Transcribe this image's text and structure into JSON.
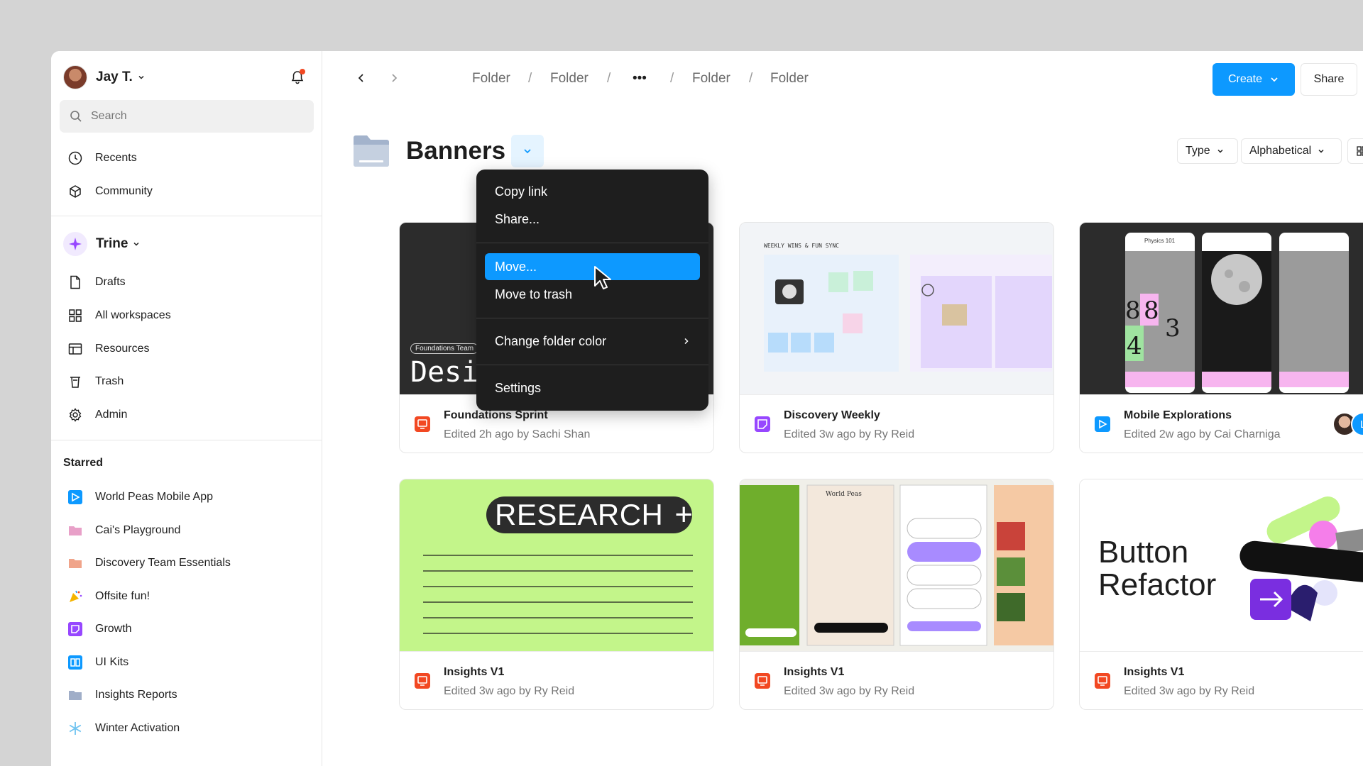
{
  "user": {
    "name": "Jay T."
  },
  "search": {
    "placeholder": "Search"
  },
  "sidebar": {
    "top_items": [
      {
        "label": "Recents",
        "icon": "clock-icon"
      },
      {
        "label": "Community",
        "icon": "globe-box-icon"
      }
    ],
    "team": {
      "name": "Trine"
    },
    "team_items": [
      {
        "label": "Drafts",
        "icon": "file-icon"
      },
      {
        "label": "All workspaces",
        "icon": "grid-icon"
      },
      {
        "label": "Resources",
        "icon": "layout-icon"
      },
      {
        "label": "Trash",
        "icon": "trash-icon"
      },
      {
        "label": "Admin",
        "icon": "gear-icon"
      }
    ],
    "starred_heading": "Starred",
    "starred": [
      {
        "label": "World Peas Mobile App",
        "icon": "prototype-file-icon",
        "color": "#0d99ff"
      },
      {
        "label": "Cai's Playground",
        "icon": "folder-icon",
        "color": "#e8a0c8"
      },
      {
        "label": "Discovery Team Essentials",
        "icon": "folder-icon",
        "color": "#f0a48a"
      },
      {
        "label": "Offsite fun!",
        "icon": "party-icon",
        "color": "#f5b400"
      },
      {
        "label": "Growth",
        "icon": "figjam-file-icon",
        "color": "#9747ff"
      },
      {
        "label": "UI Kits",
        "icon": "book-icon",
        "color": "#0d99ff"
      },
      {
        "label": "Insights Reports",
        "icon": "folder-icon",
        "color": "#a0aec8"
      },
      {
        "label": "Winter Activation",
        "icon": "snowflake-icon",
        "color": "#6fc3f0"
      }
    ]
  },
  "breadcrumbs": [
    "Folder",
    "Folder",
    "•••",
    "Folder",
    "Folder"
  ],
  "actions": {
    "create": "Create",
    "share": "Share"
  },
  "folder": {
    "title": "Banners"
  },
  "filters": {
    "type": "Type",
    "sort": "Alphabetical"
  },
  "menu": {
    "items": [
      "Copy link",
      "Share...",
      "Move...",
      "Move to trash",
      "Change folder color",
      "Settings"
    ],
    "active": "Move..."
  },
  "cards": [
    {
      "title": "Foundations Sprint",
      "meta": "Edited 2h ago by Sachi Shan",
      "icon": "slides-file-icon",
      "thumb_text": "Design S",
      "thumb_tag": "Foundations Team"
    },
    {
      "title": "Discovery Weekly",
      "meta": "Edited 3w ago by Ry Reid",
      "icon": "figjam-file-icon",
      "thumb_text": "WEEKLY WINS & FUN SYNC"
    },
    {
      "title": "Mobile Explorations",
      "meta": "Edited 2w ago by Cai Charniga",
      "icon": "prototype-file-icon",
      "avatar_letter": "L",
      "thumb_text": "Physics 101"
    },
    {
      "title": "Insights V1",
      "meta": "Edited 3w ago by Ry Reid",
      "icon": "slides-file-icon",
      "thumb_text": "RESEARCH"
    },
    {
      "title": "Insights V1",
      "meta": "Edited 3w ago by Ry Reid",
      "icon": "slides-file-icon",
      "thumb_text": "World Peas"
    },
    {
      "title": "Insights V1",
      "meta": "Edited 3w ago by Ry Reid",
      "icon": "slides-file-icon",
      "thumb_text": "Button Refactor"
    }
  ],
  "colors": {
    "accent": "#0d99ff",
    "menu_bg": "#1e1e1e",
    "slides": "#f24822",
    "figjam": "#9747ff"
  }
}
